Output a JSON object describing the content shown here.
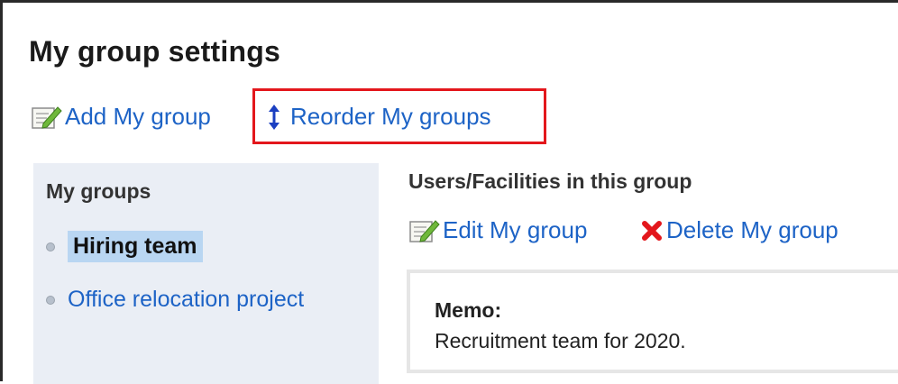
{
  "page": {
    "title": "My group settings"
  },
  "toolbar": {
    "add_label": "Add My group",
    "add_icon": "edit-note-icon",
    "reorder_label": "Reorder My groups",
    "reorder_icon": "up-down-arrow-icon",
    "highlight_color": "#e3171c"
  },
  "sidebar": {
    "title": "My groups",
    "items": [
      {
        "label": "Hiring team",
        "selected": true
      },
      {
        "label": "Office relocation project",
        "selected": false
      }
    ]
  },
  "main": {
    "section_title": "Users/Facilities in this group",
    "edit_label": "Edit My group",
    "edit_icon": "edit-note-icon",
    "delete_label": "Delete My group",
    "delete_icon": "red-x-icon",
    "memo": {
      "label": "Memo:",
      "text": "Recruitment team for 2020."
    }
  },
  "colors": {
    "link": "#1d63c6",
    "sidebar_bg": "#eaeef5",
    "selected_bg": "#b9d6f2",
    "delete_icon": "#e3171c"
  }
}
